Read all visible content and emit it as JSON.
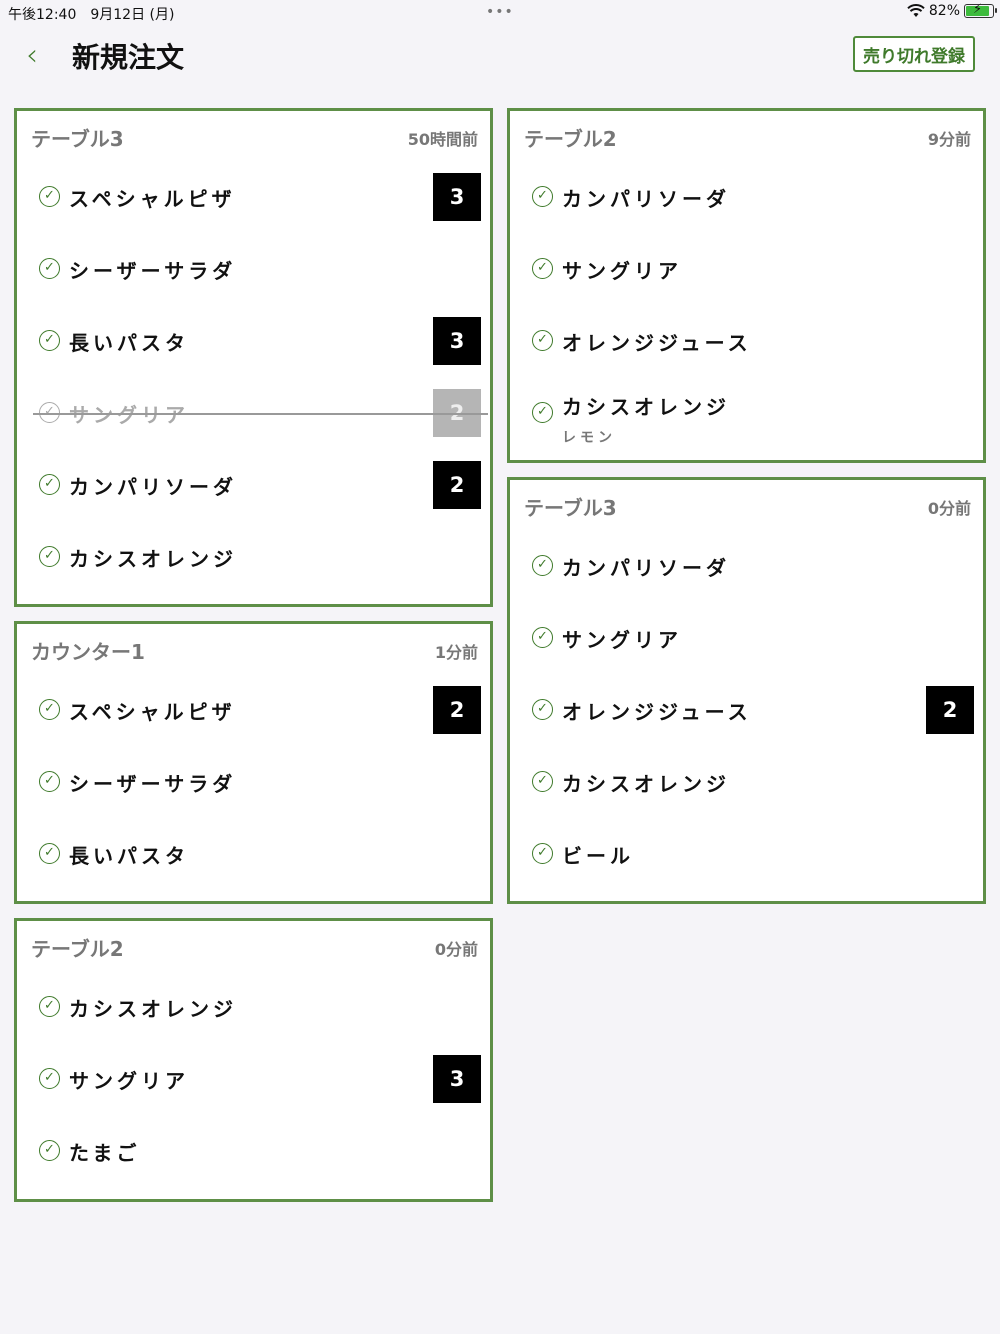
{
  "status": {
    "time": "午後12:40　9月12日 (月)",
    "dots": "•••",
    "battery": "82%",
    "battery_level": 0.82
  },
  "nav": {
    "title": "新規注文",
    "soldout_label": "売り切れ登録"
  },
  "cards": [
    {
      "name": "テーブル3",
      "time": "50時間前",
      "items": [
        {
          "name": "スペシャルピザ",
          "qty": "3"
        },
        {
          "name": "シーザーサラダ"
        },
        {
          "name": "長いパスタ",
          "qty": "3"
        },
        {
          "name": "サングリア",
          "qty": "2",
          "done": true
        },
        {
          "name": "カンパリソーダ",
          "qty": "2"
        },
        {
          "name": "カシスオレンジ"
        }
      ]
    },
    {
      "name": "カウンター1",
      "time": "1分前",
      "items": [
        {
          "name": "スペシャルピザ",
          "qty": "2"
        },
        {
          "name": "シーザーサラダ"
        },
        {
          "name": "長いパスタ"
        }
      ]
    },
    {
      "name": "テーブル2",
      "time": "0分前",
      "items": [
        {
          "name": "カシスオレンジ"
        },
        {
          "name": "サングリア",
          "qty": "3"
        },
        {
          "name": "たまご"
        }
      ]
    },
    {
      "name": "テーブル2",
      "time": "9分前",
      "items": [
        {
          "name": "カンパリソーダ"
        },
        {
          "name": "サングリア"
        },
        {
          "name": "オレンジジュース"
        },
        {
          "name": "カシスオレンジ",
          "sub": "レモン"
        }
      ]
    },
    {
      "name": "テーブル3",
      "time": "0分前",
      "items": [
        {
          "name": "カンパリソーダ"
        },
        {
          "name": "サングリア"
        },
        {
          "name": "オレンジジュース",
          "qty": "2"
        },
        {
          "name": "カシスオレンジ"
        },
        {
          "name": "ビール"
        }
      ]
    }
  ]
}
